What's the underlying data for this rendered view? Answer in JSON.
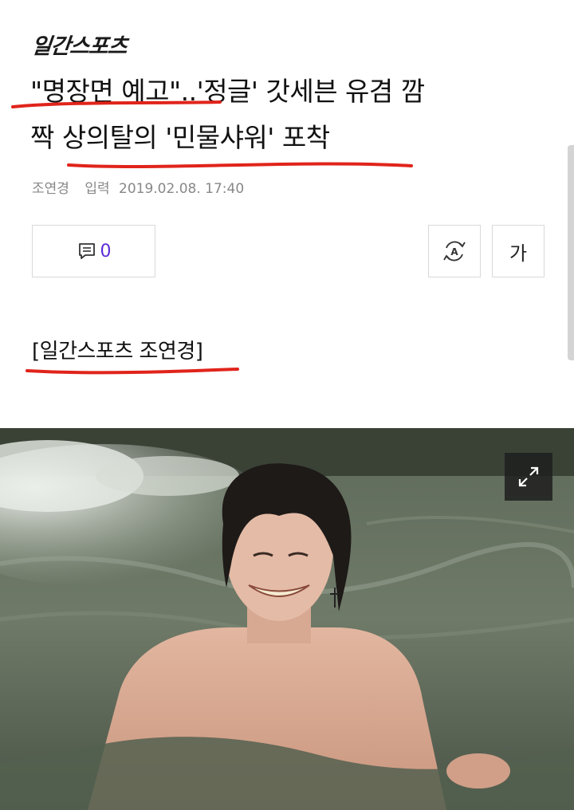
{
  "publication": {
    "name": "일간스포츠"
  },
  "article": {
    "headline_line1": "\"명장면 예고\"..'정글' 갓세븐 유겸 깜",
    "headline_line2": "짝 상의탈의 '민물샤워' 포착",
    "author": "조연경",
    "published_label": "입력",
    "published_at": "2019.02.08. 17:40",
    "photo_credit": "[일간스포츠 조연경]"
  },
  "toolbar": {
    "comment_count": "0",
    "font_size_label": "가",
    "comment_icon": "comment-icon",
    "summary_icon": "auto-summary-icon"
  },
  "photo": {
    "expand_icon": "expand-icon"
  },
  "colors": {
    "comment_count": "#5a2bd6",
    "annotation_underline": "#e0241b",
    "byline_text": "#888888"
  }
}
